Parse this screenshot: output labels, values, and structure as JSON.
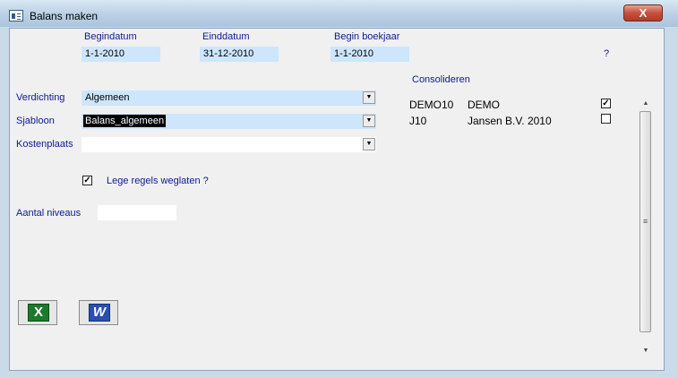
{
  "window": {
    "title": "Balans maken",
    "close_symbol": "X"
  },
  "dates": {
    "begindatum_label": "Begindatum",
    "begindatum_value": "1-1-2010",
    "einddatum_label": "Einddatum",
    "einddatum_value": "31-12-2010",
    "begin_boekjaar_label": "Begin boekjaar",
    "begin_boekjaar_value": "1-1-2010",
    "help_label": "?"
  },
  "form": {
    "verdichting_label": "Verdichting",
    "verdichting_value": "Algemeen",
    "sjabloon_label": "Sjabloon",
    "sjabloon_value": "Balans_algemeen",
    "kostenplaats_label": "Kostenplaats",
    "kostenplaats_value": "",
    "lege_regels_label": "Lege regels weglaten ?",
    "lege_regels_checked": true,
    "aantal_niveaus_label": "Aantal niveaus",
    "aantal_niveaus_value": ""
  },
  "consolideren": {
    "title": "Consolideren",
    "rows": [
      {
        "code": "DEMO10",
        "name": "DEMO",
        "checked": true
      },
      {
        "code": "J10",
        "name": "Jansen B.V. 2010",
        "checked": false
      }
    ]
  },
  "buttons": {
    "excel_glyph": "X",
    "word_glyph": "W"
  },
  "icons": {
    "dropdown": "▼",
    "scroll_up": "▲",
    "scroll_down": "▼",
    "grip": "≡",
    "check": "✓"
  },
  "colors": {
    "field_bg": "#cde6fb",
    "label": "#0b1a8c",
    "window_frame": "#c9dbe9",
    "client_bg": "#f0f0f0"
  }
}
